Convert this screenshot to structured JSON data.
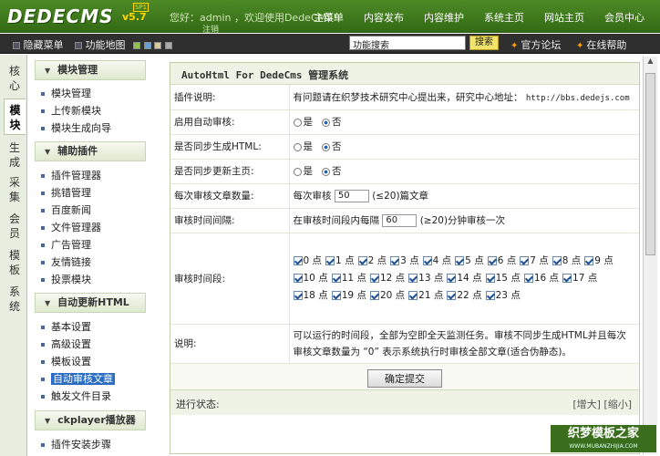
{
  "header": {
    "logo": "DEDECMS",
    "version": "v5.7",
    "version_badge": "SP1",
    "welcome": "您好：admin ，欢迎使用DedeCMS!",
    "logout": "注销",
    "nav": [
      "主菜单",
      "内容发布",
      "内容维护",
      "系统主页",
      "网站主页",
      "会员中心"
    ]
  },
  "toolbar": {
    "hide_menu": "隐藏菜单",
    "feature_map": "功能地图",
    "search_value": "功能搜索",
    "search_btn": "搜索",
    "forum": "官方论坛",
    "help": "在线帮助"
  },
  "vtabs": [
    "核心",
    "模块",
    "生成",
    "采集",
    "会员",
    "模板",
    "系统"
  ],
  "sidebar": {
    "sections": [
      {
        "title": "模块管理",
        "items": [
          "模块管理",
          "上传新模块",
          "模块生成向导"
        ]
      },
      {
        "title": "辅助插件",
        "items": [
          "插件管理器",
          "挑错管理",
          "百度新闻",
          "文件管理器",
          "广告管理",
          "友情链接",
          "投票模块"
        ]
      },
      {
        "title": "自动更新HTML",
        "items": [
          "基本设置",
          "高级设置",
          "模板设置",
          "自动审核文章",
          "触发文件目录"
        ]
      },
      {
        "title": "ckplayer播放器",
        "items": [
          "插件安装步骤"
        ]
      }
    ]
  },
  "main": {
    "title": "AutoHtml For DedeCms 管理系统",
    "rows": {
      "plugin_desc_label": "插件说明:",
      "plugin_desc": "有问题请在织梦技术研究中心提出来，研究中心地址：",
      "plugin_url": "http://bbs.dedejs.com",
      "auto_audit_label": "启用自动审核:",
      "sync_html_label": "是否同步生成HTML:",
      "sync_home_label": "是否同步更新主页:",
      "yes": "是",
      "no": "否",
      "per_count_label": "每次审核文章数量:",
      "per_count_prefix": "每次审核",
      "per_count_value": "50",
      "per_count_suffix": "(≤20)篇文章",
      "interval_label": "审核时间间隔:",
      "interval_prefix": "在审核时间段内每隔",
      "interval_value": "60",
      "interval_suffix": "(≥20)分钟审核一次",
      "period_label": "审核时间段:",
      "hour_unit": "点",
      "note_label": "说明:",
      "note": "可以运行的时间段，全部为空即全天监测任务。审核不同步生成HTML并且每次审核文章数量为 “0” 表示系统执行时审核全部文章(适合伪静态)。"
    },
    "hours": [
      "0",
      "1",
      "2",
      "3",
      "4",
      "5",
      "6",
      "7",
      "8",
      "9",
      "10",
      "11",
      "12",
      "13",
      "14",
      "15",
      "16",
      "17",
      "18",
      "19",
      "20",
      "21",
      "22",
      "23"
    ],
    "submit": "确定提交",
    "progress_label": "进行状态:",
    "zoom": "[增大] [缩小]"
  },
  "watermark": {
    "title": "织梦模板之家",
    "url": "WWW.MUBANZHIJIA.COM"
  }
}
